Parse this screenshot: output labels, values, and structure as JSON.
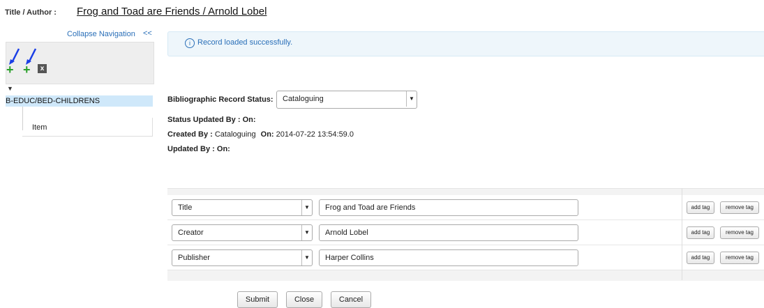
{
  "header": {
    "title_label": "Title / Author :",
    "title_value": "Frog and Toad are Friends / Arnold Lobel"
  },
  "nav": {
    "collapse_label": "Collapse Navigation",
    "collapse_arrows": "<<",
    "tree_node": "B-EDUC/BED-CHILDRENS",
    "tree_item": "Item"
  },
  "alert": {
    "icon": "i",
    "message": "Record loaded successfully."
  },
  "status": {
    "label": "Bibliographic Record Status:",
    "value": "Cataloguing",
    "status_updated_label": "Status Updated By :",
    "on_label": "On:",
    "created_label": "Created By :",
    "created_by": "Cataloguing",
    "created_on": "2014-07-22 13:54:59.0",
    "updated_label": "Updated By :"
  },
  "fields": [
    {
      "tag": "Title",
      "value": "Frog and Toad are Friends"
    },
    {
      "tag": "Creator",
      "value": "Arnold Lobel"
    },
    {
      "tag": "Publisher",
      "value": "Harper Collins"
    }
  ],
  "row_buttons": {
    "add": "add tag",
    "remove": "remove tag"
  },
  "buttons": {
    "submit": "Submit",
    "close": "Close",
    "cancel": "Cancel"
  },
  "colors": {
    "accent": "#2a6fb8",
    "alert_bg": "#eef6fb",
    "tree_selected": "#cfe8fa",
    "plus": "#2aa02a"
  }
}
